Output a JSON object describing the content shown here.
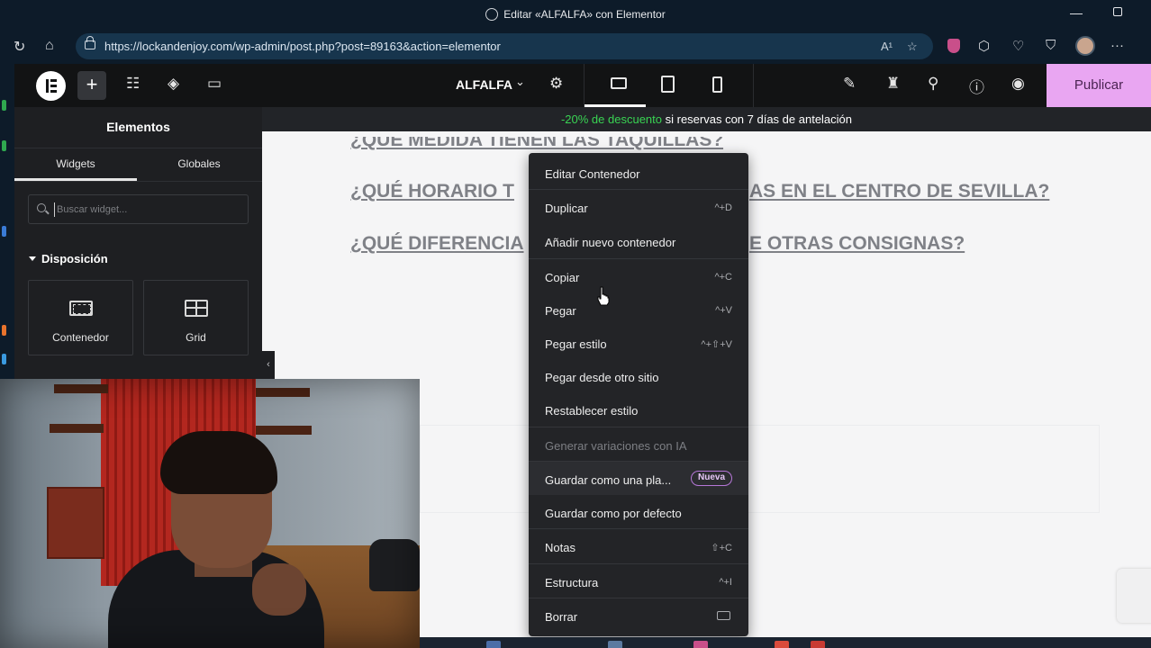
{
  "browser": {
    "window_title": "Editar «ALFALFA» con Elementor",
    "url": "https://lockandenjoy.com/wp-admin/post.php?post=89163&action=elementor",
    "read_aloud": "A¹",
    "icons": [
      "refresh-icon",
      "home-icon",
      "lock-icon",
      "read-aloud-icon",
      "favorite-icon",
      "extension-icon",
      "browser-essentials-icon",
      "shield-icon",
      "profile-avatar",
      "more-icon"
    ]
  },
  "elementor_bar": {
    "page_name": "ALFALFA",
    "publish_label": "Publicar",
    "add_label": "+"
  },
  "panel": {
    "title": "Elementos",
    "tabs": [
      "Widgets",
      "Globales"
    ],
    "search_placeholder": "Buscar widget...",
    "category": "Disposición",
    "widgets": [
      {
        "label": "Contenedor",
        "icon": "container-icon"
      },
      {
        "label": "Grid",
        "icon": "grid-icon"
      }
    ]
  },
  "canvas": {
    "promo_highlight": "-20% de descuento",
    "promo_rest": " si reservas con 7 días de antelación",
    "faq": [
      "¿QUÉ MEDIDA TIENEN LAS TAQUILLAS?",
      "¿QUÉ HORARIO TIENEN LAS TAQUILLAS EN EL CENTRO DE SEVILLA?",
      "¿QUÉ DIFERENCIAS TIENEN CON RESPECTO A OTRAS CONSIGNAS?"
    ],
    "faq_visible": [
      "¿QUE MEDIDA TIENEN LAS TAQUILLAS?",
      "¿QUÉ HORARIO T",
      "AS EN EL CENTRO DE SEVILLA?",
      "¿QUÉ DIFERENCIA",
      "E OTRAS CONSIGNAS?"
    ]
  },
  "context_menu": {
    "items": [
      {
        "label": "Editar Contenedor",
        "shortcut": ""
      },
      {
        "label": "Duplicar",
        "shortcut": "^+D"
      },
      {
        "label": "Añadir nuevo contenedor",
        "shortcut": ""
      },
      {
        "label": "Copiar",
        "shortcut": "^+C"
      },
      {
        "label": "Pegar",
        "shortcut": "^+V"
      },
      {
        "label": "Pegar estilo",
        "shortcut": "^+⇧+V"
      },
      {
        "label": "Pegar desde otro sitio",
        "shortcut": ""
      },
      {
        "label": "Restablecer estilo",
        "shortcut": ""
      },
      {
        "label": "Generar variaciones con IA",
        "shortcut": "",
        "disabled": true
      },
      {
        "label": "Guardar como una pla...",
        "badge": "Nueva"
      },
      {
        "label": "Guardar como por defecto",
        "shortcut": ""
      },
      {
        "label": "Notas",
        "shortcut": "⇧+C"
      },
      {
        "label": "Estructura",
        "shortcut": "^+I"
      },
      {
        "label": "Borrar",
        "shortcut": ""
      }
    ]
  },
  "colors": {
    "publish_bg": "#e9a6f2",
    "promo_highlight": "#39d353",
    "badge_border": "#b677d8"
  }
}
